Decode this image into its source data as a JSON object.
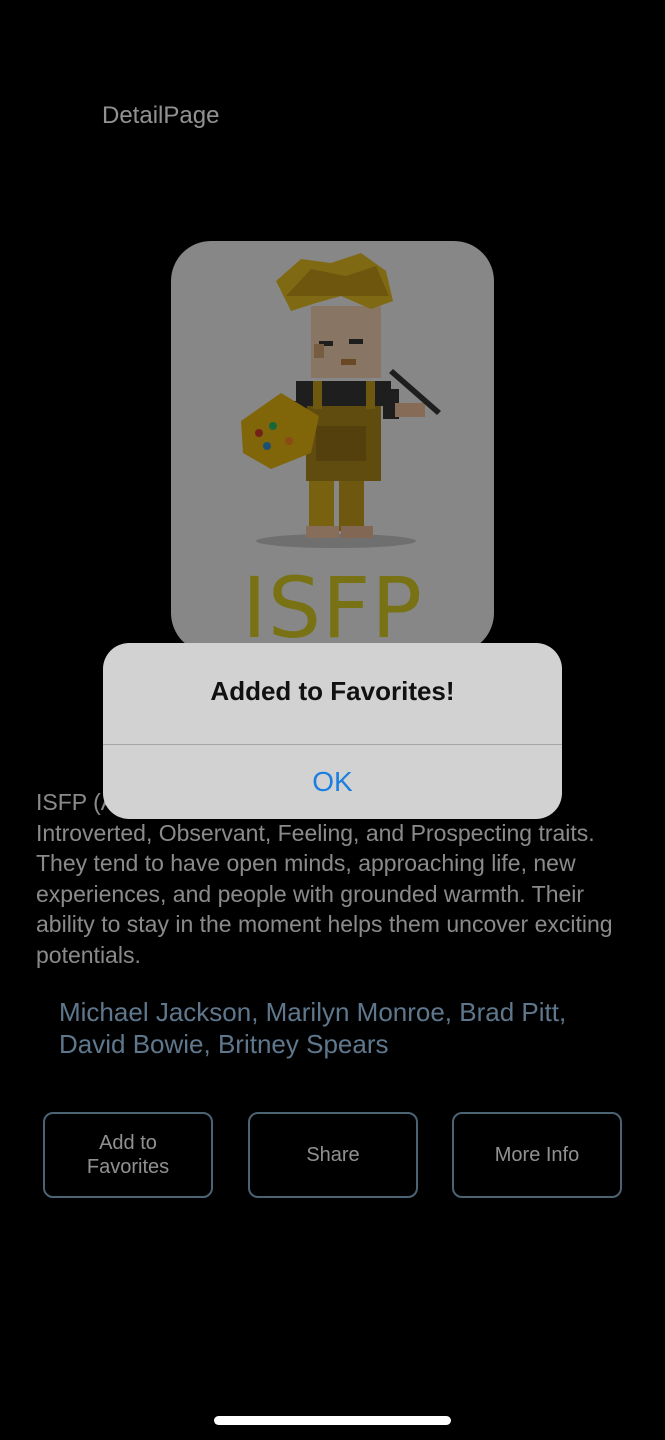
{
  "header": {
    "title": "DetailPage"
  },
  "card": {
    "type_label": "ISFP",
    "illustration": "artist-character-illustration"
  },
  "description": "ISFP (Adventurer) personality types possess the Introverted, Observant, Feeling, and Prospecting traits. They tend to have open minds, approaching life, new experiences, and people with grounded warmth. Their ability to stay in the moment helps them uncover exciting potentials.",
  "celebrities": "Michael Jackson, Marilyn Monroe, Brad Pitt, David Bowie, Britney Spears",
  "actions": {
    "add_to_favorites": "Add to\nFavorites",
    "share": "Share",
    "more_info": "More Info"
  },
  "alert": {
    "title": "Added to Favorites!",
    "ok_label": "OK"
  },
  "colors": {
    "background": "#000000",
    "celebrity_text": "#9ec7ea",
    "button_border": "#7fa6c2",
    "alert_ok": "#1a7fe0",
    "type_label": "#c9bf22"
  }
}
